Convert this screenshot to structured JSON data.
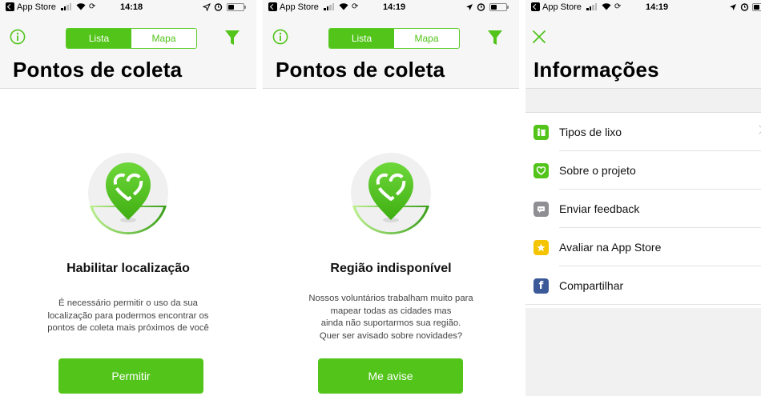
{
  "colors": {
    "accent": "#52c41a",
    "facebook": "#3b5998",
    "star": "#f5c400",
    "feedback": "#8e8e93"
  },
  "screen1": {
    "status": {
      "carrier": "App Store",
      "time": "14:18"
    },
    "segment": {
      "list": "Lista",
      "map": "Mapa"
    },
    "title": "Pontos de coleta",
    "headline": "Habilitar localização",
    "body": "É necessário permitir o uso da sua\nlocalização para podermos encontrar os\npontos de coleta mais próximos de você",
    "button": "Permitir"
  },
  "screen2": {
    "status": {
      "carrier": "App Store",
      "time": "14:19"
    },
    "segment": {
      "list": "Lista",
      "map": "Mapa"
    },
    "title": "Pontos de coleta",
    "headline": "Região indisponível",
    "body": "Nossos voluntários trabalham muito para\nmapear todas as cidades mas\nainda não suportarmos sua região.\nQuer ser avisado sobre novidades?",
    "button": "Me avise"
  },
  "screen3": {
    "status": {
      "carrier": "App Store",
      "time": "14:19"
    },
    "title": "Informações",
    "menu": [
      {
        "label": "Tipos de lixo",
        "icon": "trash-types-icon"
      },
      {
        "label": "Sobre o projeto",
        "icon": "heart-icon"
      },
      {
        "label": "Enviar feedback",
        "icon": "chat-bubble-icon"
      },
      {
        "label": "Avaliar na App Store",
        "icon": "star-icon"
      },
      {
        "label": "Compartilhar",
        "icon": "facebook-icon"
      }
    ]
  }
}
